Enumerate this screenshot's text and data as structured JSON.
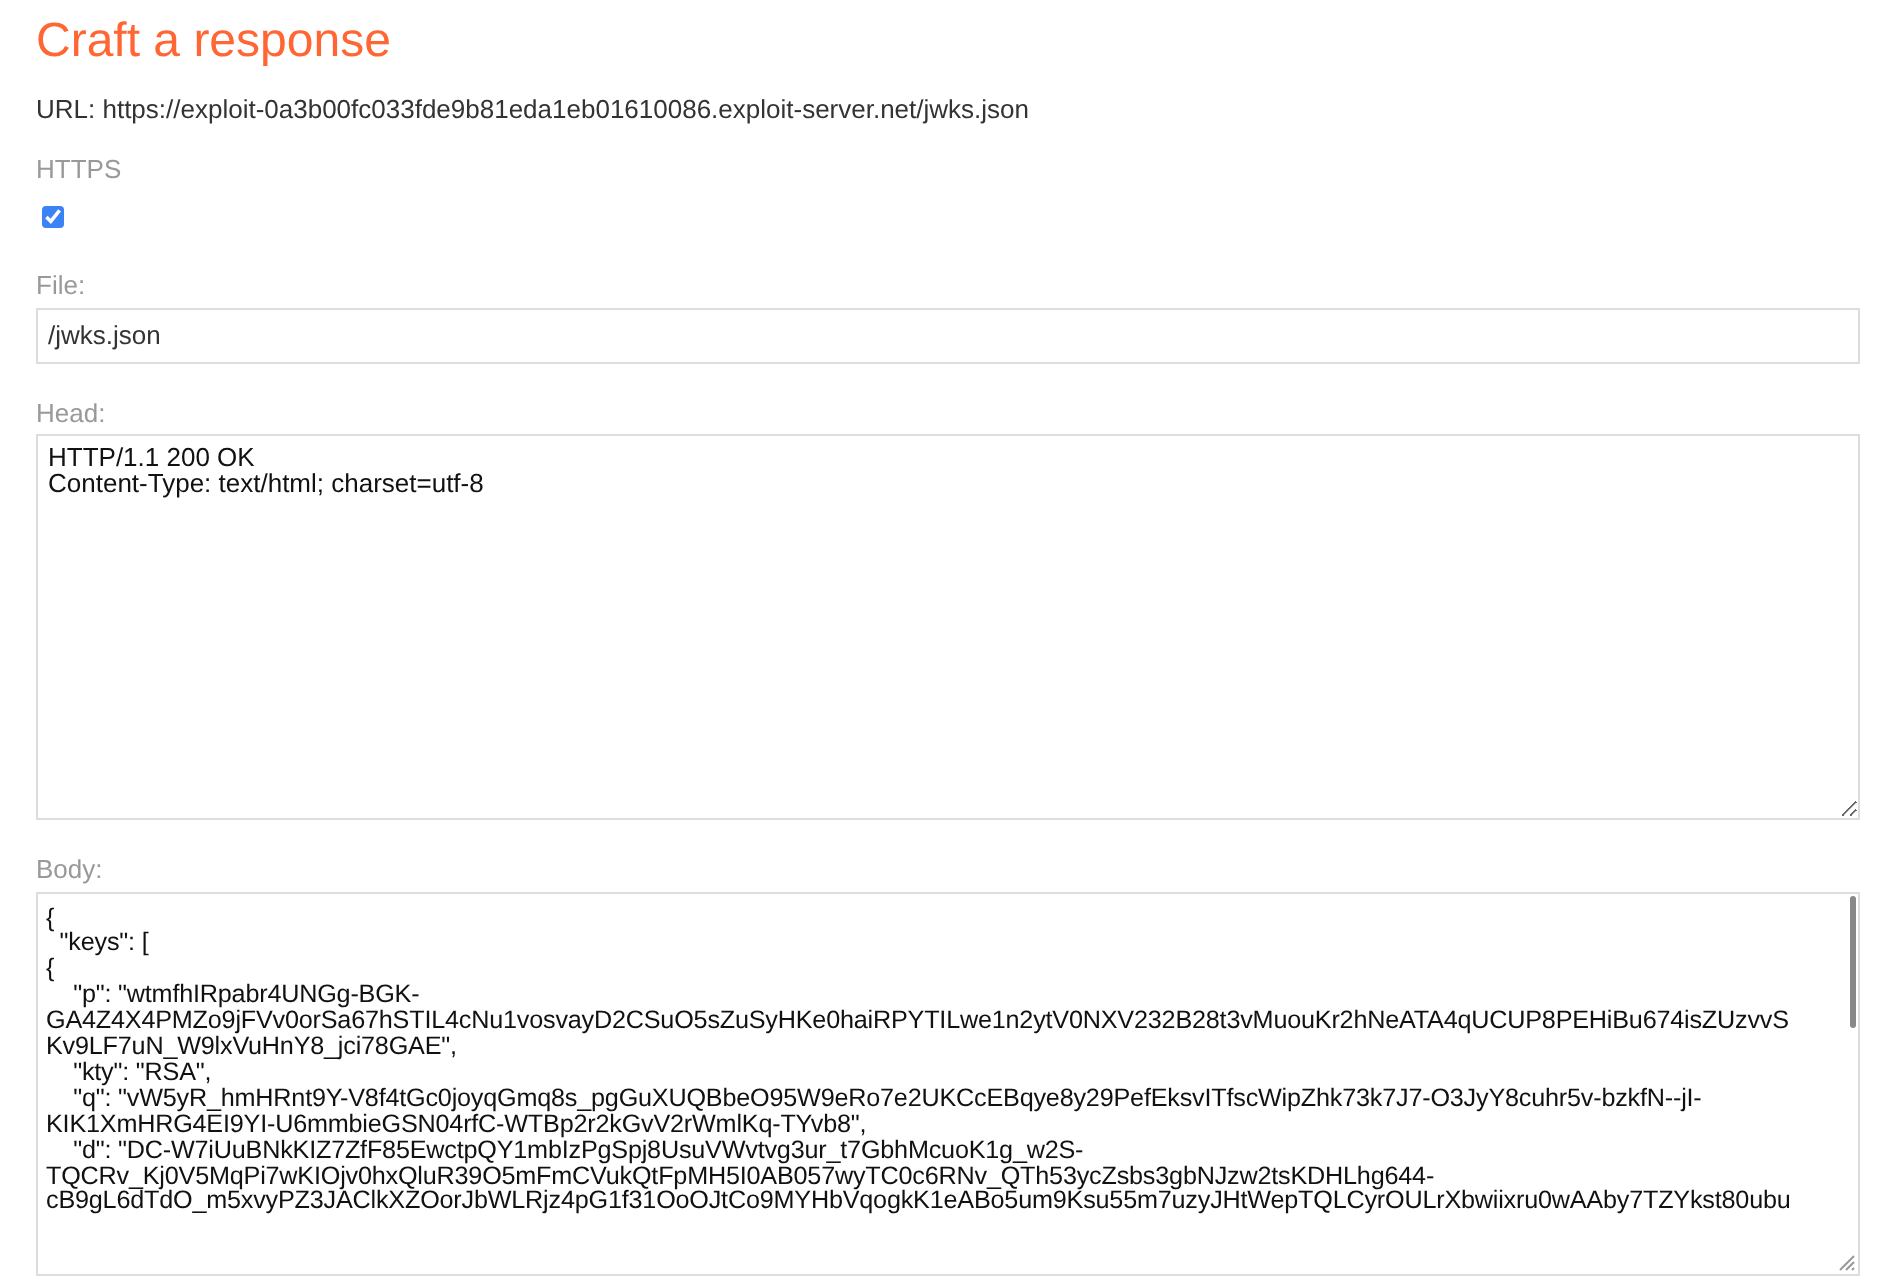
{
  "title": "Craft a response",
  "url": "URL: https://exploit-0a3b00fc033fde9b81eda1eb01610086.exploit-server.net/jwks.json",
  "https": {
    "label": "HTTPS",
    "checked": true
  },
  "file": {
    "label": "File:",
    "value": "/jwks.json"
  },
  "head": {
    "label": "Head:",
    "lines": [
      "HTTP/1.1 200 OK",
      "Content-Type: text/html; charset=utf-8"
    ]
  },
  "body": {
    "label": "Body:",
    "lines": [
      "{",
      "  \"keys\": [",
      "{",
      "    \"p\": \"wtmfhIRpabr4UNGg-BGK-",
      "GA4Z4X4PMZo9jFVv0orSa67hSTIL4cNu1vosvayD2CSuO5sZuSyHKe0haiRPYTILwe1n2ytV0NXV232B28t3vMuouKr2hNeATA4qUCUP8PEHiBu674isZUzvvS",
      "Kv9LF7uN_W9lxVuHnY8_jci78GAE\",",
      "    \"kty\": \"RSA\",",
      "    \"q\": \"vW5yR_hmHRnt9Y-V8f4tGc0joyqGmq8s_pgGuXUQBbeO95W9eRo7e2UKCcEBqye8y29PefEksvITfscWipZhk73k7J7-O3JyY8cuhr5v-bzkfN--jI-",
      "KIK1XmHRG4EI9YI-U6mmbieGSN04rfC-WTBp2r2kGvV2rWmlKq-TYvb8\",",
      "    \"d\": \"DC-W7iUuBNkKIZ7ZfF85EwctpQY1mbIzPgSpj8UsuVWvtvg3ur_t7GbhMcuoK1g_w2S-",
      "TQCRv_Kj0V5MqPi7wKIOjv0hxQluR39O5mFmCVukQtFpMH5I0AB057wyTC0c6RNv_QTh53ycZsbs3gbNJzw2tsKDHLhg644-",
      "cB9gL6dTdO_m5xvyPZ3JAClkXZOorJbWLRjz4pG1f31OoOJtCo9MYHbVqogkK1eABo5um9Ksu55m7uzyJHtWepTQLCyrOULrXbwiixru0wAAby7TZYkst80ubu"
    ]
  }
}
